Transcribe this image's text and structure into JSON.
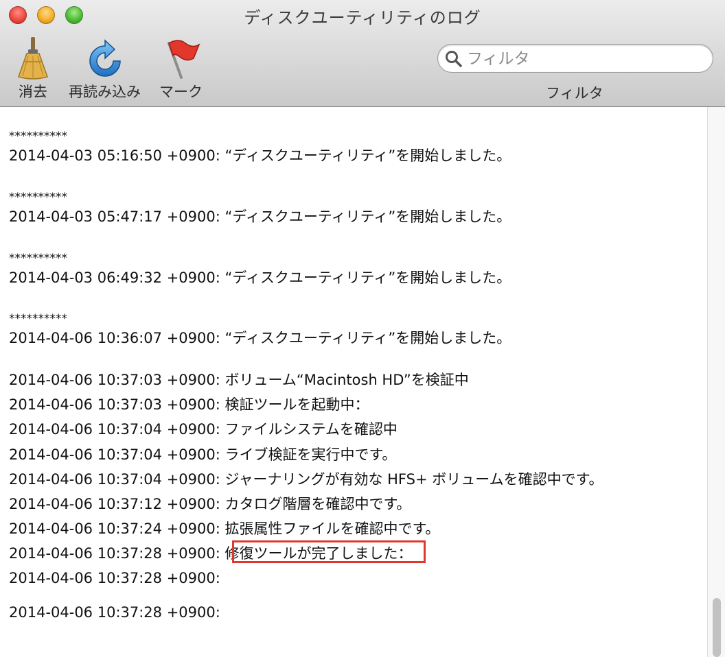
{
  "window": {
    "title": "ディスクユーティリティのログ"
  },
  "toolbar": {
    "clear_label": "消去",
    "reload_label": "再読み込み",
    "mark_label": "マーク",
    "filter_label": "フィルタ",
    "search_placeholder": "フィルタ"
  },
  "icons": {
    "clear": "broom-icon",
    "reload": "reload-icon",
    "mark": "flag-icon",
    "search": "magnifier-icon"
  },
  "colors": {
    "highlight": "#e2372b"
  },
  "log": {
    "lines": [
      "**********",
      "2014-04-03 05:16:50 +0900: “ディスクユーティリティ”を開始しました。",
      "**********",
      "2014-04-03 05:47:17 +0900: “ディスクユーティリティ”を開始しました。",
      "**********",
      "2014-04-03 06:49:32 +0900: “ディスクユーティリティ”を開始しました。",
      "**********",
      "2014-04-06 10:36:07 +0900: “ディスクユーティリティ”を開始しました。",
      "2014-04-06 10:37:03 +0900: ボリューム“Macintosh HD”を検証中",
      "2014-04-06 10:37:03 +0900: 検証ツールを起動中：",
      "2014-04-06 10:37:04 +0900: ファイルシステムを確認中",
      "2014-04-06 10:37:04 +0900: ライブ検証を実行中です。",
      "2014-04-06 10:37:04 +0900: ジャーナリングが有効な HFS+ ボリュームを確認中です。",
      "2014-04-06 10:37:12 +0900: カタログ階層を確認中です。",
      "2014-04-06 10:37:24 +0900: 拡張属性ファイルを確認中です。",
      "2014-04-06 10:37:28 +0900: 修復ツールが完了しました：",
      "2014-04-06 10:37:28 +0900:",
      "2014-04-06 10:37:28 +0900:"
    ]
  }
}
